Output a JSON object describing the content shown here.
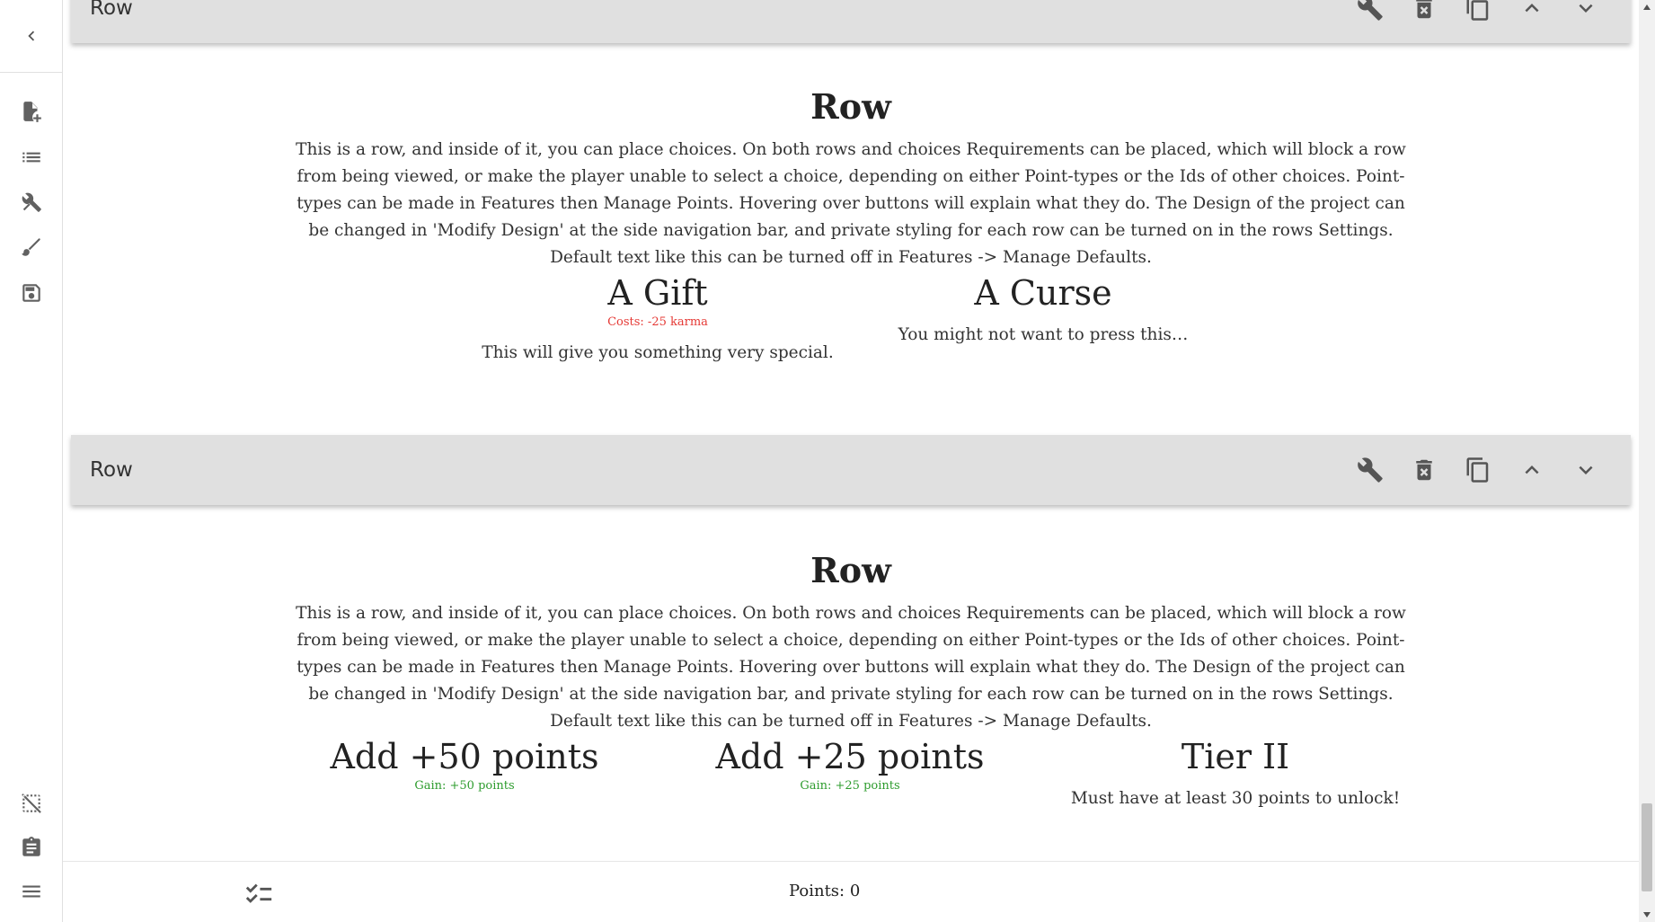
{
  "rows": [
    {
      "toolbar_title": "Row",
      "title": "Row",
      "text": "This is a row, and inside of it, you can place choices. On both rows and choices Requirements can be placed, which will block a row from being viewed, or make the player unable to select a choice, depending on either Point-types or the Ids of other choices. Point-types can be made in Features then Manage Points. Hovering over buttons will explain what they do. The Design of the project can be changed in 'Modify Design' at the side navigation bar, and private styling for each row can be turned on in the rows Settings. Default text like this can be turned off in Features -> Manage Defaults.",
      "choices": [
        {
          "title": "A Gift",
          "score": "Costs: -25  karma",
          "text": "This will give you something very special."
        },
        {
          "title": "A Curse",
          "text": "You might not want to press this…"
        }
      ]
    },
    {
      "toolbar_title": "Row",
      "title": "Row",
      "text": "This is a row, and inside of it, you can place choices. On both rows and choices Requirements can be placed, which will block a row from being viewed, or make the player unable to select a choice, depending on either Point-types or the Ids of other choices. Point-types can be made in Features then Manage Points. Hovering over buttons will explain what they do. The Design of the project can be changed in 'Modify Design' at the side navigation bar, and private styling for each row can be turned on in the rows Settings. Default text like this can be turned off in Features -> Manage Defaults.",
      "choices": [
        {
          "title": "Add +50 points",
          "score": "Gain: +50  points"
        },
        {
          "title": "Add +25 points",
          "score": "Gain: +25  points"
        },
        {
          "title": "Tier II",
          "text": "Must have at least 30 points to unlock!"
        }
      ]
    }
  ],
  "bottom_bar": {
    "points": "Points: 0"
  },
  "icons": {
    "nav": [
      "back-chevron-icon",
      "new-file-icon",
      "list-icon",
      "tools-icon",
      "brush-icon",
      "save-icon",
      "select-off-icon",
      "clipboard-icon",
      "menu-icon"
    ],
    "row_toolbar": [
      "wrench-icon",
      "delete-icon",
      "copy-icon",
      "chevron-up-icon",
      "chevron-down-icon"
    ],
    "bottom": [
      "checklist-icon"
    ]
  },
  "colors": {
    "cost": "#e53935",
    "gain": "#2e9c2e",
    "toolbar": "#e0e0e0"
  }
}
